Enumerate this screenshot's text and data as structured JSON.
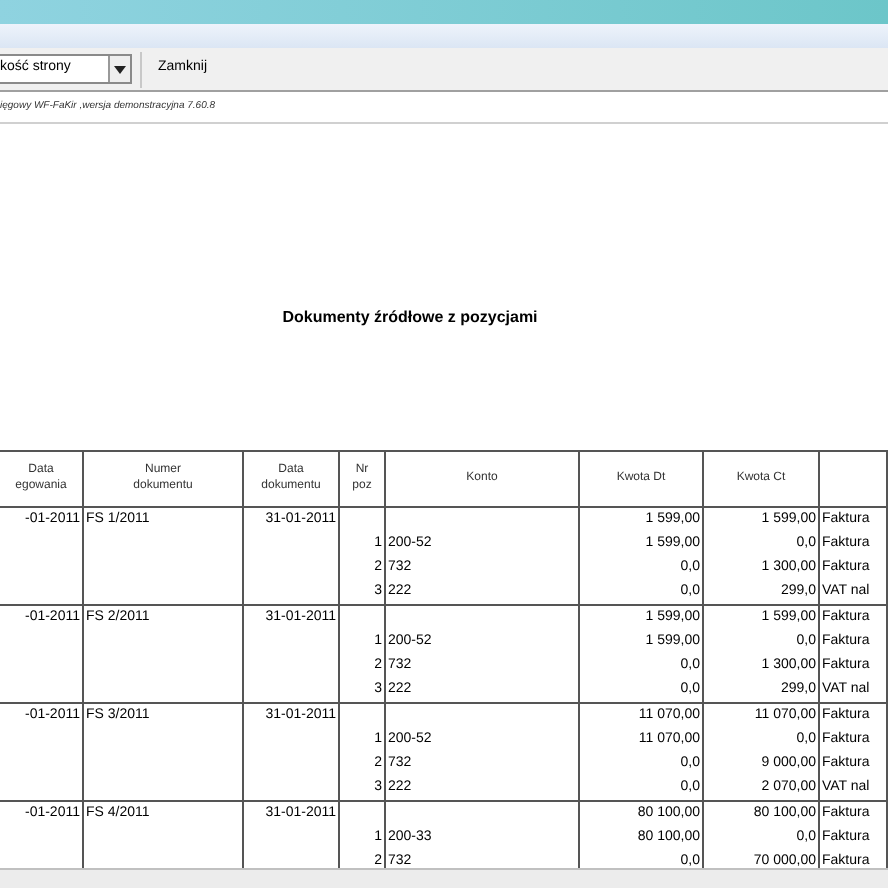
{
  "toolbar": {
    "page_size_select": {
      "value": "kość strony"
    },
    "close_button": "Zamknij"
  },
  "status_text": "ięgowy WF-FaKir ,wersja demonstracyjna 7.60.8",
  "report": {
    "title": "Dokumenty źródłowe z pozycjami",
    "table": {
      "columns": [
        {
          "lines": [
            "Data",
            "egowania"
          ]
        },
        {
          "lines": [
            "Numer",
            "dokumentu"
          ]
        },
        {
          "lines": [
            "Data",
            "dokumentu"
          ]
        },
        {
          "lines": [
            "Nr",
            "poz"
          ]
        },
        {
          "lines": [
            "Konto"
          ]
        },
        {
          "lines": [
            "Kwota Dt"
          ]
        },
        {
          "lines": [
            "Kwota Ct"
          ]
        },
        {}
      ],
      "documents": [
        {
          "posting_date": "-01-2011",
          "number": "FS 1/2011",
          "doc_date": "31-01-2011",
          "dt": "1 599,00",
          "ct": "1 599,00",
          "description": "Faktura",
          "positions": [
            {
              "nr": "1",
              "account": "200-52",
              "dt": "1 599,00",
              "ct": "0,0",
              "description": "Faktura"
            },
            {
              "nr": "2",
              "account": "732",
              "dt": "0,0",
              "ct": "1 300,00",
              "description": "Faktura"
            },
            {
              "nr": "3",
              "account": "222",
              "dt": "0,0",
              "ct": "299,0",
              "description": "VAT nal"
            }
          ]
        },
        {
          "posting_date": "-01-2011",
          "number": "FS 2/2011",
          "doc_date": "31-01-2011",
          "dt": "1 599,00",
          "ct": "1 599,00",
          "description": "Faktura",
          "positions": [
            {
              "nr": "1",
              "account": "200-52",
              "dt": "1 599,00",
              "ct": "0,0",
              "description": "Faktura"
            },
            {
              "nr": "2",
              "account": "732",
              "dt": "0,0",
              "ct": "1 300,00",
              "description": "Faktura"
            },
            {
              "nr": "3",
              "account": "222",
              "dt": "0,0",
              "ct": "299,0",
              "description": "VAT nal"
            }
          ]
        },
        {
          "posting_date": "-01-2011",
          "number": "FS 3/2011",
          "doc_date": "31-01-2011",
          "dt": "11 070,00",
          "ct": "11 070,00",
          "description": "Faktura",
          "positions": [
            {
              "nr": "1",
              "account": "200-52",
              "dt": "11 070,00",
              "ct": "0,0",
              "description": "Faktura"
            },
            {
              "nr": "2",
              "account": "732",
              "dt": "0,0",
              "ct": "9 000,00",
              "description": "Faktura"
            },
            {
              "nr": "3",
              "account": "222",
              "dt": "0,0",
              "ct": "2 070,00",
              "description": "VAT nal"
            }
          ]
        },
        {
          "posting_date": "-01-2011",
          "number": "FS 4/2011",
          "doc_date": "31-01-2011",
          "dt": "80 100,00",
          "ct": "80 100,00",
          "description": "Faktura",
          "positions": [
            {
              "nr": "1",
              "account": "200-33",
              "dt": "80 100,00",
              "ct": "0,0",
              "description": "Faktura"
            },
            {
              "nr": "2",
              "account": "732",
              "dt": "0,0",
              "ct": "70 000,00",
              "description": "Faktura"
            }
          ]
        }
      ]
    }
  }
}
